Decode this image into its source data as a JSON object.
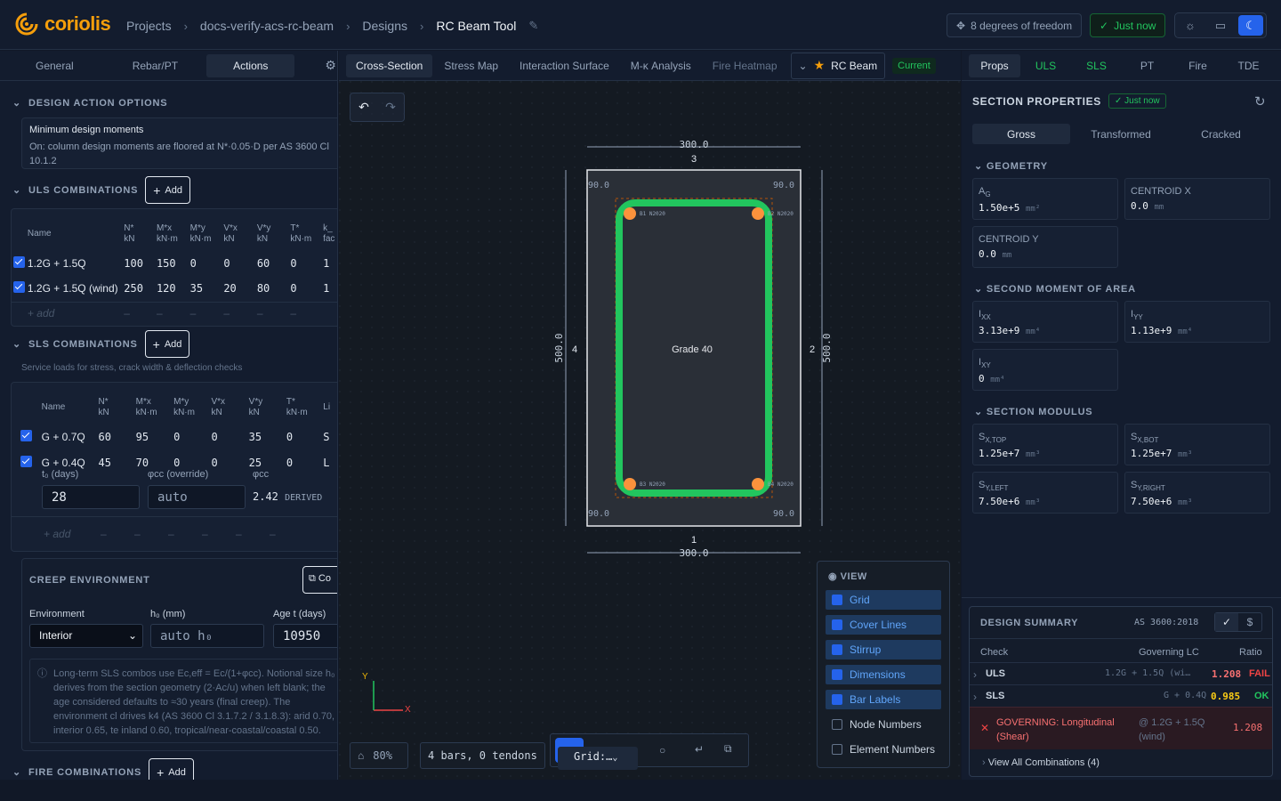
{
  "app": {
    "name": "coriolis"
  },
  "breadcrumb": [
    "Projects",
    "docs-verify-acs-rc-beam",
    "Designs",
    "RC Beam Tool"
  ],
  "topbar": {
    "dof": "8 degrees of freedom",
    "saved": "Just now"
  },
  "left": {
    "tabs": [
      "General",
      "Rebar/PT",
      "Actions"
    ],
    "active_tab": "Actions",
    "design_action_options": {
      "title": "DESIGN ACTION OPTIONS",
      "heading": "Minimum design moments",
      "text": "On: column design moments are floored at N*·0.05·D per AS 3600 Cl 10.1.2"
    },
    "uls": {
      "title": "ULS COMBINATIONS",
      "add": "Add",
      "headers": [
        [
          "Name",
          ""
        ],
        [
          "N*",
          "kN"
        ],
        [
          "M*x",
          "kN·m"
        ],
        [
          "M*y",
          "kN·m"
        ],
        [
          "V*x",
          "kN"
        ],
        [
          "V*y",
          "kN"
        ],
        [
          "T*",
          "kN·m"
        ],
        [
          "k_",
          "fac"
        ]
      ],
      "rows": [
        [
          "1.2G + 1.5Q",
          "100",
          "150",
          "0",
          "0",
          "60",
          "0",
          "1"
        ],
        [
          "1.2G + 1.5Q (wind)",
          "250",
          "120",
          "35",
          "20",
          "80",
          "0",
          "1"
        ]
      ],
      "add_row": "+ add"
    },
    "sls": {
      "title": "SLS COMBINATIONS",
      "add": "Add",
      "subtitle": "Service loads for stress, crack width & deflection checks",
      "headers": [
        [
          "Name",
          ""
        ],
        [
          "N*",
          "kN"
        ],
        [
          "M*x",
          "kN·m"
        ],
        [
          "M*y",
          "kN·m"
        ],
        [
          "V*x",
          "kN"
        ],
        [
          "V*y",
          "kN"
        ],
        [
          "T*",
          "kN·m"
        ],
        [
          "Li",
          ""
        ]
      ],
      "rows": [
        [
          "G + 0.7Q",
          "60",
          "95",
          "0",
          "0",
          "35",
          "0",
          "S"
        ],
        [
          "G + 0.4Q",
          "45",
          "70",
          "0",
          "0",
          "25",
          "0",
          "L"
        ]
      ],
      "t0_label": "t₀ (days)",
      "t0_value": "28",
      "phicc_override_label": "φcc (override)",
      "phicc_override_placeholder": "auto",
      "phicc_label": "φcc",
      "phicc_value": "2.42",
      "phicc_tag": "DERIVED",
      "add_row": "+ add"
    },
    "creep": {
      "title": "CREEP ENVIRONMENT",
      "copy": "Co",
      "env_label": "Environment",
      "env_value": "Interior",
      "h0_label": "h₀ (mm)",
      "h0_placeholder": "auto h₀",
      "age_label": "Age t (days)",
      "age_value": "10950",
      "note": "Long-term SLS combos use Ec,eff = Ec/(1+φcc). Notional size h₀ derives from the section geometry (2·Ac/u) when left blank; the age considered defaults to ≈30 years (final creep). The environment cl drives k4 (AS 3600 Cl 3.1.7.2 / 3.1.8.3): arid 0.70, interior 0.65, te inland 0.60, tropical/near-coastal/coastal 0.50."
    },
    "fire": {
      "title": "FIRE COMBINATIONS",
      "add": "Add"
    }
  },
  "center": {
    "tabs": [
      "Cross-Section",
      "Stress Map",
      "Interaction Surface",
      "M-κ Analysis",
      "Fire Heatmap"
    ],
    "active_tab": "Cross-Section",
    "design_name": "RC Beam",
    "design_status": "Current",
    "section": {
      "width": "300.0",
      "depth": "500.0",
      "grade": "Grade 40",
      "cover": "90.0",
      "edges": [
        "1",
        "2",
        "3",
        "4"
      ],
      "bars": [
        {
          "id": "B1",
          "label": "B1 N2020"
        },
        {
          "id": "B2",
          "label": "B2 N2020"
        },
        {
          "id": "B3",
          "label": "B3 N2020"
        },
        {
          "id": "B4",
          "label": "B4 N2020"
        }
      ]
    },
    "axes": {
      "x": "X",
      "y": "Y"
    },
    "bottom": {
      "zoom": "80%",
      "status": "4 bars, 0 tendons",
      "grid": "Grid:…"
    },
    "view": {
      "title": "VIEW",
      "items": [
        {
          "label": "Grid",
          "on": true
        },
        {
          "label": "Cover Lines",
          "on": true
        },
        {
          "label": "Stirrup",
          "on": true
        },
        {
          "label": "Dimensions",
          "on": true
        },
        {
          "label": "Bar Labels",
          "on": true
        },
        {
          "label": "Node Numbers",
          "on": false
        },
        {
          "label": "Element Numbers",
          "on": false
        }
      ]
    }
  },
  "right": {
    "tabs": [
      "Props",
      "ULS",
      "SLS",
      "PT",
      "Fire",
      "TDE"
    ],
    "active_tab": "Props",
    "title": "SECTION PROPERTIES",
    "saved": "Just now",
    "modes": [
      "Gross",
      "Transformed",
      "Cracked"
    ],
    "geometry": {
      "title": "GEOMETRY",
      "cards": [
        {
          "l": "A",
          "s": "G",
          "v": "1.50e+5",
          "u": "mm²"
        },
        {
          "l": "CENTROID X",
          "s": "",
          "v": "0.0",
          "u": "mm"
        },
        {
          "l": "CENTROID Y",
          "s": "",
          "v": "0.0",
          "u": "mm"
        }
      ]
    },
    "second_moment": {
      "title": "SECOND MOMENT OF AREA",
      "cards": [
        {
          "l": "I",
          "s": "XX",
          "v": "3.13e+9",
          "u": "mm⁴"
        },
        {
          "l": "I",
          "s": "YY",
          "v": "1.13e+9",
          "u": "mm⁴"
        },
        {
          "l": "I",
          "s": "XY",
          "v": "0",
          "u": "mm⁴"
        }
      ]
    },
    "modulus": {
      "title": "SECTION MODULUS",
      "cards": [
        {
          "l": "S",
          "s": "X,TOP",
          "v": "1.25e+7",
          "u": "mm³"
        },
        {
          "l": "S",
          "s": "X,BOT",
          "v": "1.25e+7",
          "u": "mm³"
        },
        {
          "l": "S",
          "s": "Y,LEFT",
          "v": "7.50e+6",
          "u": "mm³"
        },
        {
          "l": "S",
          "s": "Y,RIGHT",
          "v": "7.50e+6",
          "u": "mm³"
        }
      ]
    },
    "summary": {
      "title": "DESIGN SUMMARY",
      "code": "AS 3600:2018",
      "headers": [
        "Check",
        "Governing LC",
        "Ratio"
      ],
      "rows": [
        {
          "check": "ULS",
          "lc": "1.2G + 1.5Q (wi…",
          "ratio": "1.208",
          "status": "FAIL"
        },
        {
          "check": "SLS",
          "lc": "G + 0.4Q",
          "ratio": "0.985",
          "status": "OK"
        }
      ],
      "governing": "GOVERNING: Longitudinal (Shear)",
      "governing_lc": "@ 1.2G + 1.5Q (wind)",
      "governing_ratio": "1.208",
      "view_all": "View All Combinations (4)"
    },
    "colors": {
      "accent": "#2563eb",
      "ok": "#22c55e",
      "fail": "#ef4444",
      "brand": "#f59e0b",
      "bar": "#fb923c"
    }
  }
}
